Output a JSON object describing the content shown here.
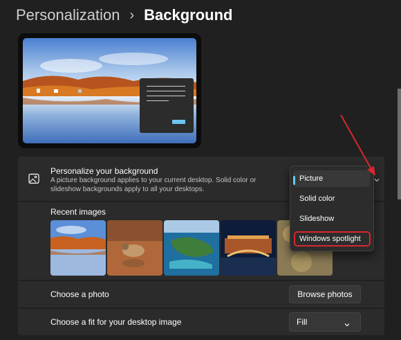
{
  "breadcrumb": {
    "parent": "Personalization",
    "separator": "›",
    "current": "Background"
  },
  "personalize": {
    "title": "Personalize your background",
    "description": "A picture background applies to your current desktop. Solid color or slideshow backgrounds apply to all your desktops."
  },
  "dropdown": {
    "selected": "Picture",
    "options": [
      "Picture",
      "Solid color",
      "Slideshow",
      "Windows spotlight"
    ]
  },
  "recent": {
    "label": "Recent images"
  },
  "choose_photo": {
    "label": "Choose a photo",
    "button": "Browse photos"
  },
  "fit": {
    "label": "Choose a fit for your desktop image",
    "value": "Fill"
  },
  "colors": {
    "accent": "#60cdff",
    "annotation": "#d9262e",
    "card": "#2b2b2b",
    "background": "#202020"
  }
}
